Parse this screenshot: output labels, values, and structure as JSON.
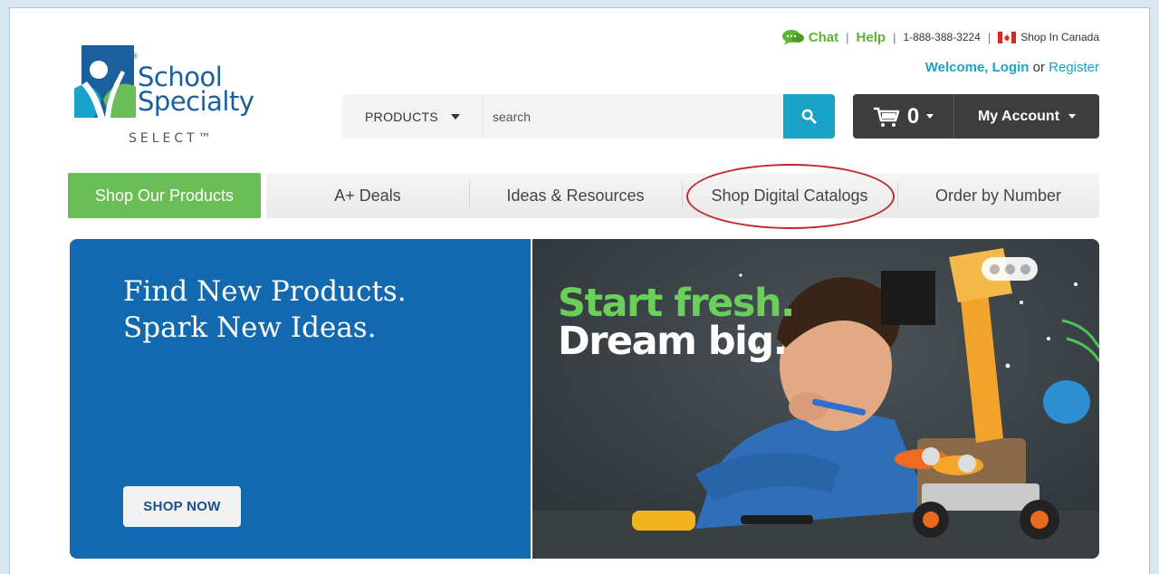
{
  "logo": {
    "line1": "School",
    "line2": "Specialty",
    "sub": "SELECT™",
    "reg": "®",
    "colors": {
      "blue": "#1b5f9e",
      "green": "#6bbd55",
      "teal": "#1aa3c8"
    }
  },
  "util": {
    "chat": "Chat",
    "help": "Help",
    "phone": "1-888-388-3224",
    "canada": "Shop In Canada",
    "sep": "|",
    "icons": [
      "chat-bubble-icon",
      "canada-flag-icon"
    ]
  },
  "welcome": {
    "text": "Welcome, Login",
    "or": " or ",
    "register": "Register"
  },
  "search": {
    "category": "PRODUCTS",
    "placeholder": "search",
    "icon": "search-icon"
  },
  "cart": {
    "count": "0",
    "account": "My Account",
    "icon": "cart-icon"
  },
  "nav": {
    "primary": "Shop Our Products",
    "tabs": [
      {
        "label": "A+ Deals"
      },
      {
        "label": "Ideas & Resources"
      },
      {
        "label": "Shop Digital Catalogs"
      },
      {
        "label": "Order by Number"
      }
    ]
  },
  "hero": {
    "line1": "Find New Products.",
    "line2": "Spark New Ideas.",
    "button": "SHOP NOW",
    "promo1": "Start fresh.",
    "promo2": "Dream big.",
    "colors": {
      "panel": "#1269b0",
      "promo_green": "#6bd05a"
    }
  }
}
